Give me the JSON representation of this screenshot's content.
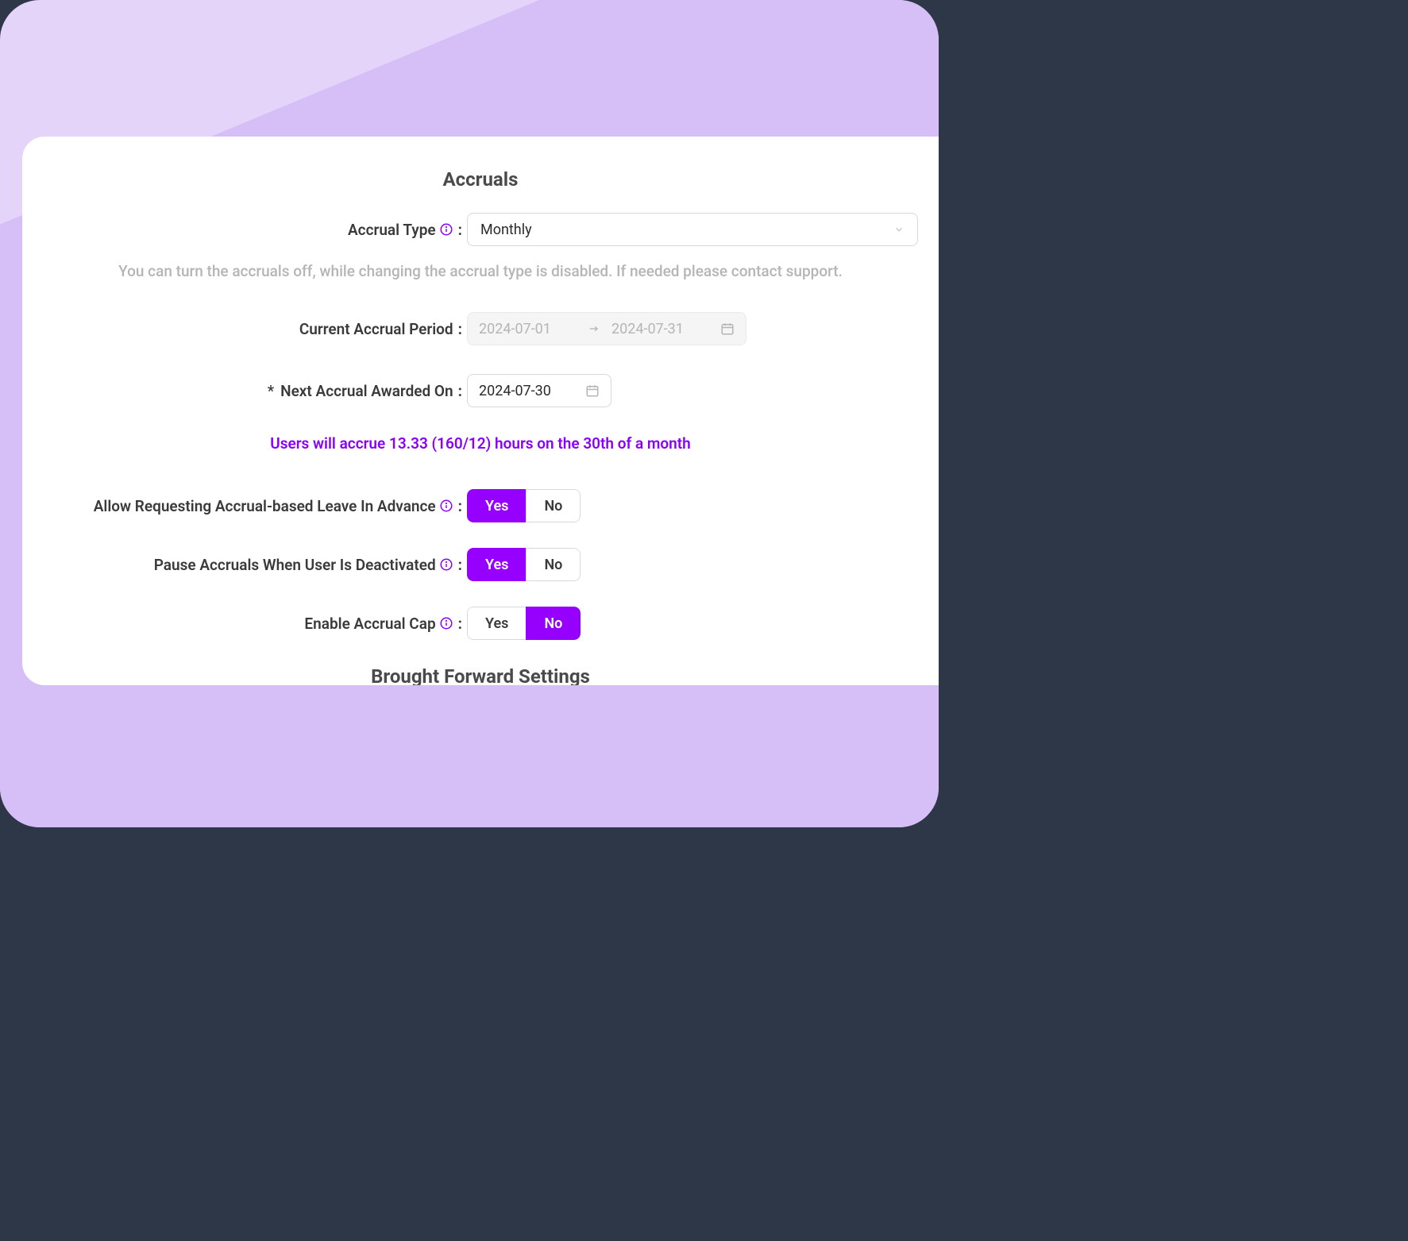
{
  "section_title": "Accruals",
  "accrual_type": {
    "label": "Accrual Type",
    "value": "Monthly"
  },
  "helper_text": "You can turn the accruals off, while changing the accrual type is disabled. If needed please contact support.",
  "current_period": {
    "label": "Current Accrual Period",
    "start": "2024-07-01",
    "end": "2024-07-31"
  },
  "next_awarded": {
    "label": "Next Accrual Awarded On",
    "value": "2024-07-30"
  },
  "accrue_message": "Users will accrue 13.33 (160/12) hours on the 30th of a month",
  "allow_advance": {
    "label": "Allow Requesting Accrual-based Leave In Advance",
    "yes": "Yes",
    "no": "No",
    "value": "Yes"
  },
  "pause_deactivated": {
    "label": "Pause Accruals When User Is Deactivated",
    "yes": "Yes",
    "no": "No",
    "value": "Yes"
  },
  "enable_cap": {
    "label": "Enable Accrual Cap",
    "yes": "Yes",
    "no": "No",
    "value": "No"
  },
  "next_section_title": "Brought Forward Settings"
}
